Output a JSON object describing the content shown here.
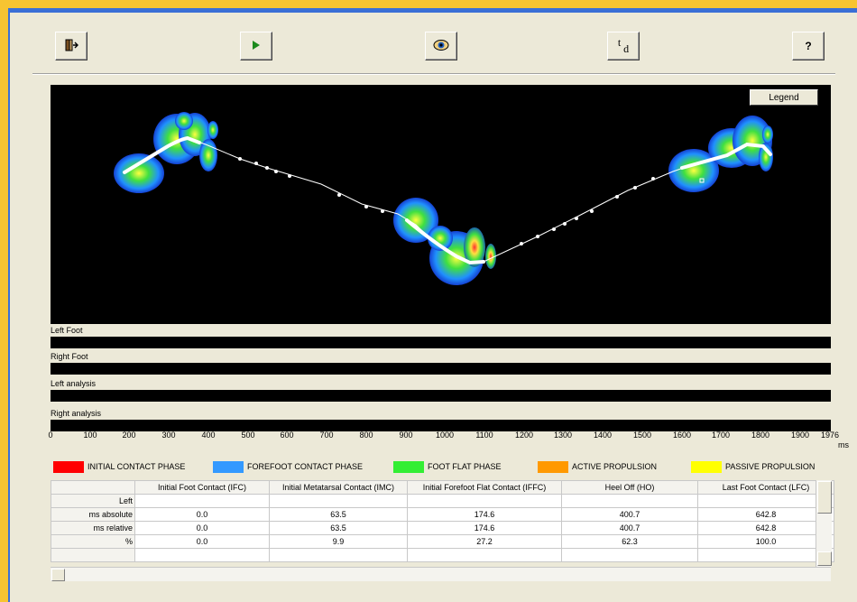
{
  "toolbar": {
    "td_label": "t",
    "td_sub": "d",
    "help_label": "?"
  },
  "plot": {
    "legend_button": "Legend"
  },
  "strips": [
    {
      "label": "Left Foot"
    },
    {
      "label": "Right Foot"
    },
    {
      "label": "Left analysis"
    },
    {
      "label": "Right analysis"
    }
  ],
  "axis": {
    "ticks": [
      "0",
      "100",
      "200",
      "300",
      "400",
      "500",
      "600",
      "700",
      "800",
      "900",
      "1000",
      "1100",
      "1200",
      "1300",
      "1400",
      "1500",
      "1600",
      "1700",
      "1800",
      "1900",
      "1976"
    ],
    "unit": "ms",
    "max": 1976
  },
  "phase_legend": [
    {
      "label": "INITIAL CONTACT PHASE",
      "color": "#ff0000"
    },
    {
      "label": "FOREFOOT CONTACT PHASE",
      "color": "#3399ff"
    },
    {
      "label": "FOOT FLAT PHASE",
      "color": "#33ee33"
    },
    {
      "label": "ACTIVE PROPULSION",
      "color": "#ff9900"
    },
    {
      "label": "PASSIVE PROPULSION",
      "color": "#ffff00"
    }
  ],
  "table": {
    "columns": [
      "",
      "Initial Foot Contact (IFC)",
      "Initial Metatarsal Contact (IMC)",
      "Initial Forefoot Flat Contact (IFFC)",
      "Heel Off (HO)",
      "Last Foot Contact (LFC)"
    ],
    "rows": [
      [
        "Left",
        "",
        "",
        "",
        "",
        ""
      ],
      [
        "ms absolute",
        "0.0",
        "63.5",
        "174.6",
        "400.7",
        "642.8"
      ],
      [
        "ms relative",
        "0.0",
        "63.5",
        "174.6",
        "400.7",
        "642.8"
      ],
      [
        "%",
        "0.0",
        "9.9",
        "27.2",
        "62.3",
        "100.0"
      ],
      [
        "",
        "",
        "",
        "",
        "",
        ""
      ]
    ]
  }
}
